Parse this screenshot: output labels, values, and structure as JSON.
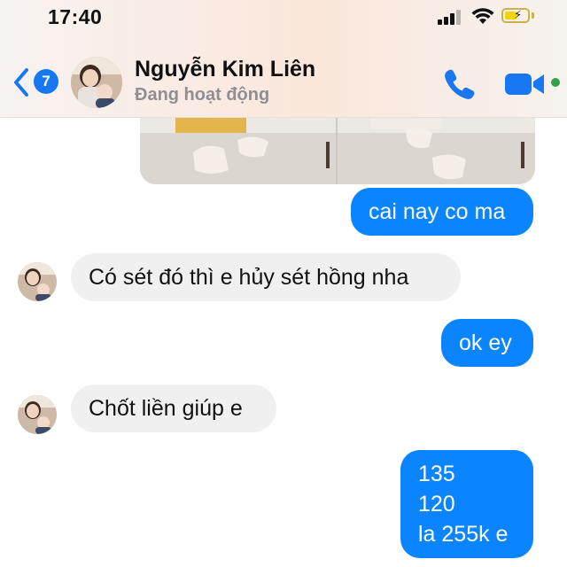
{
  "status_bar": {
    "time": "17:40"
  },
  "header": {
    "back_badge": "7",
    "contact_name": "Nguyễn Kim Liên",
    "contact_status": "Đang hoạt động"
  },
  "colors": {
    "accent": "#0a84ff",
    "incoming_bubble": "#f0f0f0",
    "online": "#31a24c"
  },
  "icons": {
    "back": "chevron-left-icon",
    "call": "phone-icon",
    "video": "video-camera-icon"
  },
  "messages": [
    {
      "id": "m1",
      "from": "me",
      "text": "cai nay co ma"
    },
    {
      "id": "m2",
      "from": "contact",
      "text": "Có sét đó thì e hủy sét hồng nha"
    },
    {
      "id": "m3",
      "from": "me",
      "text": "ok ey"
    },
    {
      "id": "m4",
      "from": "contact",
      "text": "Chốt liền giúp e"
    },
    {
      "id": "m5",
      "from": "me",
      "lines": [
        "135",
        "120",
        "la 255k e"
      ]
    }
  ]
}
